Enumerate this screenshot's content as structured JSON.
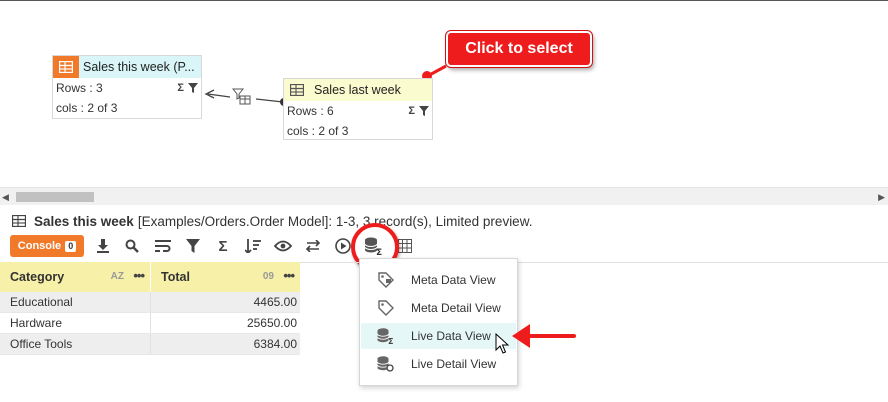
{
  "canvas": {
    "node_a": {
      "title": "Sales this week (P...",
      "rows": "Rows : 3",
      "cols": "cols : 2 of 3"
    },
    "node_b": {
      "title": "Sales last week",
      "rows": "Rows : 6",
      "cols": "cols : 2 of 3"
    },
    "callout": "Click to select",
    "colors": {
      "node_a_header": "#d9f5f7",
      "node_a_icon": "#f07a2a",
      "node_b_header": "#fbfbd0",
      "annotation": "#ee1c1c"
    }
  },
  "info": {
    "title": "Sales this week",
    "detail": "[Examples/Orders.Order Model]: 1-3, 3 record(s), Limited preview."
  },
  "toolbar": {
    "console_label": "Console",
    "console_count": "0",
    "icons": [
      "download-icon",
      "search-icon",
      "wrap-icon",
      "filter-icon",
      "sigma-icon",
      "sort-icon",
      "eye-icon",
      "swap-icon",
      "play-icon",
      "data-view-icon",
      "grid-icon"
    ],
    "accent": "#f07a2a"
  },
  "grid": {
    "columns": [
      {
        "label": "Category",
        "type_tag": "AZ"
      },
      {
        "label": "Total",
        "type_tag": "09"
      }
    ],
    "rows": [
      {
        "category": "Educational",
        "total": "4465.00"
      },
      {
        "category": "Hardware",
        "total": "25650.00"
      },
      {
        "category": "Office Tools",
        "total": "6384.00"
      }
    ],
    "header_color": "#f7f0a8"
  },
  "menu": {
    "items": [
      {
        "label": "Meta Data View",
        "icon": "tag-data-icon"
      },
      {
        "label": "Meta Detail View",
        "icon": "tag-icon"
      },
      {
        "label": "Live Data View",
        "icon": "database-sum-icon",
        "highlighted": true
      },
      {
        "label": "Live Detail View",
        "icon": "database-gear-icon"
      }
    ],
    "highlight_color": "#e6f7f8"
  }
}
